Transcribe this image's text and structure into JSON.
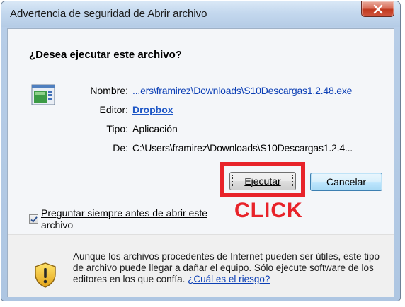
{
  "window": {
    "title": "Advertencia de seguridad de Abrir archivo",
    "close_label": "X"
  },
  "dialog": {
    "question": "¿Desea ejecutar este archivo?",
    "fields": {
      "name_label": "Nombre:",
      "name_value": "...ers\\framirez\\Downloads\\S10Descargas1.2.48.exe",
      "publisher_label": "Editor:",
      "publisher_value": "Dropbox",
      "type_label": "Tipo:",
      "type_value": "Aplicación",
      "from_label": "De:",
      "from_value": "C:\\Users\\framirez\\Downloads\\S10Descargas1.2.4..."
    },
    "buttons": {
      "run": "Ejecutar",
      "cancel": "Cancelar"
    },
    "annotation": {
      "text": "CLICK",
      "color": "#e8232a"
    },
    "checkbox": {
      "checked": true,
      "label_first": "Preguntar siempre antes de abrir este",
      "label_second": "archivo"
    },
    "warning": {
      "text": "Aunque los archivos procedentes de Internet pueden ser útiles, este tipo de archivo puede llegar a dañar el equipo. Sólo ejecute software de los editores en los que confía.",
      "link": "¿Cuál es el riesgo?"
    }
  },
  "icons": {
    "close": "close-icon",
    "file": "application-file-icon",
    "checkmark": "checkmark-icon",
    "warning": "warning-shield-icon"
  },
  "colors": {
    "title_bar": "#c4d8ee",
    "close_button": "#c0391f",
    "link": "#0c3fb5",
    "highlight": "#e8232a"
  }
}
